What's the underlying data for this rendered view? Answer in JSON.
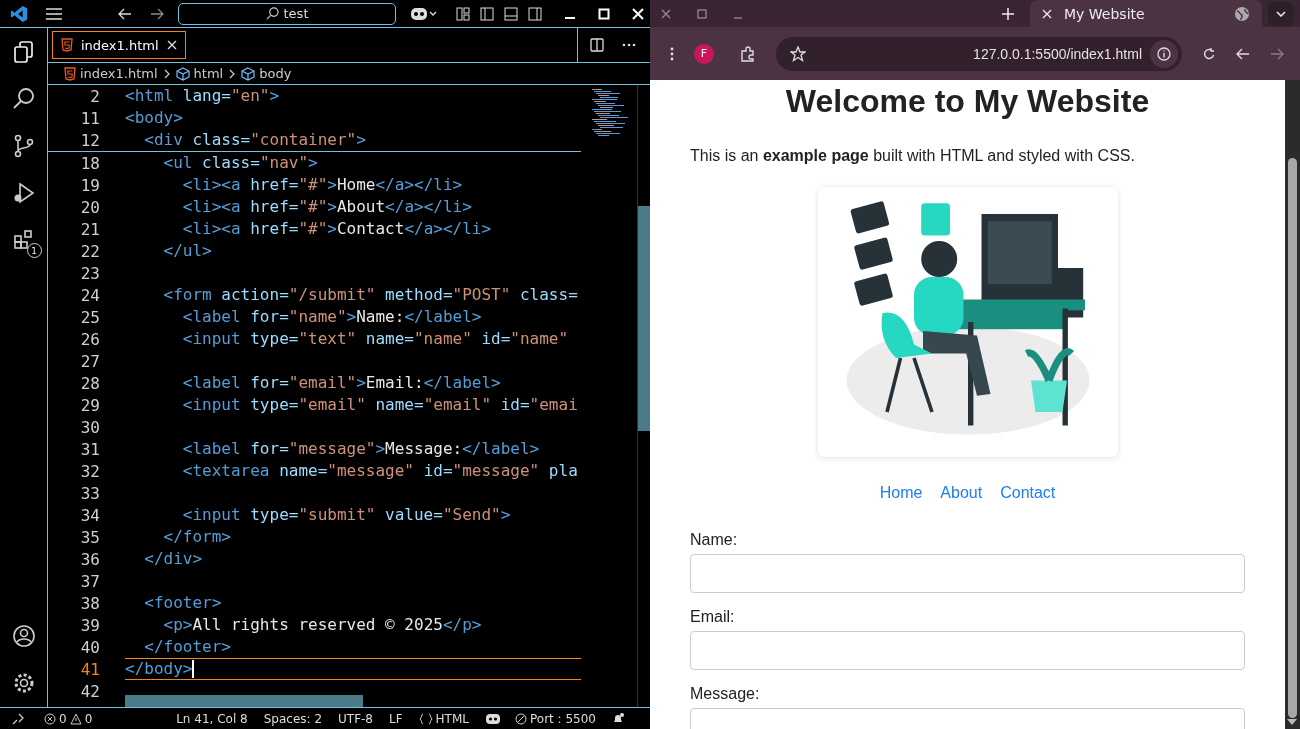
{
  "vscode": {
    "search": "test",
    "tab": {
      "label": "index1.html",
      "selected": true
    },
    "breadcrumbs": [
      "index1.html",
      "html",
      "body"
    ],
    "extensions_badge": "1",
    "sticky_lines": [
      {
        "number": "2",
        "tokens": [
          {
            "kind": "tag",
            "text": "<html"
          },
          {
            "kind": "attr",
            "text": " lang="
          },
          {
            "kind": "str",
            "text": "\"en\""
          },
          {
            "kind": "tag",
            "text": ">"
          }
        ]
      },
      {
        "number": "11",
        "tokens": [
          {
            "kind": "tag",
            "text": "<body>"
          }
        ]
      },
      {
        "number": "12",
        "tokens": [
          {
            "kind": "tag",
            "text": "  <div"
          },
          {
            "kind": "attr",
            "text": " class="
          },
          {
            "kind": "str",
            "text": "\"container\""
          },
          {
            "kind": "tag",
            "text": ">"
          }
        ]
      }
    ],
    "lines": [
      {
        "number": "18",
        "current": false,
        "tokens": [
          {
            "kind": "tag",
            "text": "    <ul"
          },
          {
            "kind": "attr",
            "text": " class="
          },
          {
            "kind": "str",
            "text": "\"nav\""
          },
          {
            "kind": "tag",
            "text": ">"
          }
        ]
      },
      {
        "number": "19",
        "current": false,
        "tokens": [
          {
            "kind": "tag",
            "text": "      <li><a"
          },
          {
            "kind": "attr",
            "text": " href="
          },
          {
            "kind": "str",
            "text": "\"#\""
          },
          {
            "kind": "tag",
            "text": ">"
          },
          {
            "kind": "text",
            "text": "Home"
          },
          {
            "kind": "tag",
            "text": "</a></li>"
          }
        ]
      },
      {
        "number": "20",
        "current": false,
        "tokens": [
          {
            "kind": "tag",
            "text": "      <li><a"
          },
          {
            "kind": "attr",
            "text": " href="
          },
          {
            "kind": "str",
            "text": "\"#\""
          },
          {
            "kind": "tag",
            "text": ">"
          },
          {
            "kind": "text",
            "text": "About"
          },
          {
            "kind": "tag",
            "text": "</a></li>"
          }
        ]
      },
      {
        "number": "21",
        "current": false,
        "tokens": [
          {
            "kind": "tag",
            "text": "      <li><a"
          },
          {
            "kind": "attr",
            "text": " href="
          },
          {
            "kind": "str",
            "text": "\"#\""
          },
          {
            "kind": "tag",
            "text": ">"
          },
          {
            "kind": "text",
            "text": "Contact"
          },
          {
            "kind": "tag",
            "text": "</a></li>"
          }
        ]
      },
      {
        "number": "22",
        "current": false,
        "tokens": [
          {
            "kind": "tag",
            "text": "    </ul>"
          }
        ]
      },
      {
        "number": "23",
        "current": false
      },
      {
        "number": "24",
        "current": false,
        "tokens": [
          {
            "kind": "tag",
            "text": "    <form"
          },
          {
            "kind": "attr",
            "text": " action="
          },
          {
            "kind": "str",
            "text": "\"/submit\""
          },
          {
            "kind": "attr",
            "text": " method="
          },
          {
            "kind": "str",
            "text": "\"POST\""
          },
          {
            "kind": "attr",
            "text": " class="
          }
        ]
      },
      {
        "number": "25",
        "current": false,
        "tokens": [
          {
            "kind": "tag",
            "text": "      <label"
          },
          {
            "kind": "attr",
            "text": " for="
          },
          {
            "kind": "str",
            "text": "\"name\""
          },
          {
            "kind": "tag",
            "text": ">"
          },
          {
            "kind": "text",
            "text": "Name:"
          },
          {
            "kind": "tag",
            "text": "</label>"
          }
        ]
      },
      {
        "number": "26",
        "current": false,
        "tokens": [
          {
            "kind": "tag",
            "text": "      <input"
          },
          {
            "kind": "attr",
            "text": " type="
          },
          {
            "kind": "str",
            "text": "\"text\""
          },
          {
            "kind": "attr",
            "text": " name="
          },
          {
            "kind": "str",
            "text": "\"name\""
          },
          {
            "kind": "attr",
            "text": " id="
          },
          {
            "kind": "str",
            "text": "\"name\""
          }
        ]
      },
      {
        "number": "27",
        "current": false
      },
      {
        "number": "28",
        "current": false,
        "tokens": [
          {
            "kind": "tag",
            "text": "      <label"
          },
          {
            "kind": "attr",
            "text": " for="
          },
          {
            "kind": "str",
            "text": "\"email\""
          },
          {
            "kind": "tag",
            "text": ">"
          },
          {
            "kind": "text",
            "text": "Email:"
          },
          {
            "kind": "tag",
            "text": "</label>"
          }
        ]
      },
      {
        "number": "29",
        "current": false,
        "tokens": [
          {
            "kind": "tag",
            "text": "      <input"
          },
          {
            "kind": "attr",
            "text": " type="
          },
          {
            "kind": "str",
            "text": "\"email\""
          },
          {
            "kind": "attr",
            "text": " name="
          },
          {
            "kind": "str",
            "text": "\"email\""
          },
          {
            "kind": "attr",
            "text": " id="
          },
          {
            "kind": "str",
            "text": "\"emai"
          }
        ]
      },
      {
        "number": "30",
        "current": false
      },
      {
        "number": "31",
        "current": false,
        "tokens": [
          {
            "kind": "tag",
            "text": "      <label"
          },
          {
            "kind": "attr",
            "text": " for="
          },
          {
            "kind": "str",
            "text": "\"message\""
          },
          {
            "kind": "tag",
            "text": ">"
          },
          {
            "kind": "text",
            "text": "Message:"
          },
          {
            "kind": "tag",
            "text": "</label>"
          }
        ]
      },
      {
        "number": "32",
        "current": false,
        "tokens": [
          {
            "kind": "tag",
            "text": "      <textarea"
          },
          {
            "kind": "attr",
            "text": " name="
          },
          {
            "kind": "str",
            "text": "\"message\""
          },
          {
            "kind": "attr",
            "text": " id="
          },
          {
            "kind": "str",
            "text": "\"message\""
          },
          {
            "kind": "attr",
            "text": " pla"
          }
        ]
      },
      {
        "number": "33",
        "current": false
      },
      {
        "number": "34",
        "current": false,
        "tokens": [
          {
            "kind": "tag",
            "text": "      <input"
          },
          {
            "kind": "attr",
            "text": " type="
          },
          {
            "kind": "str",
            "text": "\"submit\""
          },
          {
            "kind": "attr",
            "text": " value="
          },
          {
            "kind": "str",
            "text": "\"Send\""
          },
          {
            "kind": "tag",
            "text": ">"
          }
        ]
      },
      {
        "number": "35",
        "current": false,
        "tokens": [
          {
            "kind": "tag",
            "text": "    </form>"
          }
        ]
      },
      {
        "number": "36",
        "current": false,
        "tokens": [
          {
            "kind": "tag",
            "text": "  </div>"
          }
        ]
      },
      {
        "number": "37",
        "current": false
      },
      {
        "number": "38",
        "current": false,
        "tokens": [
          {
            "kind": "tag",
            "text": "  <footer>"
          }
        ]
      },
      {
        "number": "39",
        "current": false,
        "tokens": [
          {
            "kind": "tag",
            "text": "    <p>"
          },
          {
            "kind": "text",
            "text": "All rights reserved © 2025"
          },
          {
            "kind": "tag",
            "text": "</p>"
          }
        ]
      },
      {
        "number": "40",
        "current": false,
        "tokens": [
          {
            "kind": "tag",
            "text": "  </footer>"
          }
        ]
      },
      {
        "number": "41",
        "current": true,
        "tokens": [
          {
            "kind": "tag",
            "text": "</body>"
          }
        ]
      },
      {
        "number": "42",
        "current": false
      }
    ],
    "status_bar": {
      "errors": "0",
      "warnings": "0",
      "position": "Ln 41, Col 8",
      "spaces": "Spaces: 2",
      "encoding": "UTF-8",
      "eol": "LF",
      "language": "HTML",
      "port": "Port : 5500"
    }
  },
  "browser": {
    "tab_title": "My Website",
    "profile": "F",
    "url": "127.0.0.1:5500/index1.html",
    "page": {
      "heading": "Welcome to My Website",
      "intro": "This is an **example page** built with HTML and styled with CSS.",
      "nav": [
        "Home",
        "About",
        "Contact"
      ],
      "fields": [
        {
          "label": "Name:"
        },
        {
          "label": "Email:"
        },
        {
          "label": "Message:"
        }
      ]
    }
  }
}
